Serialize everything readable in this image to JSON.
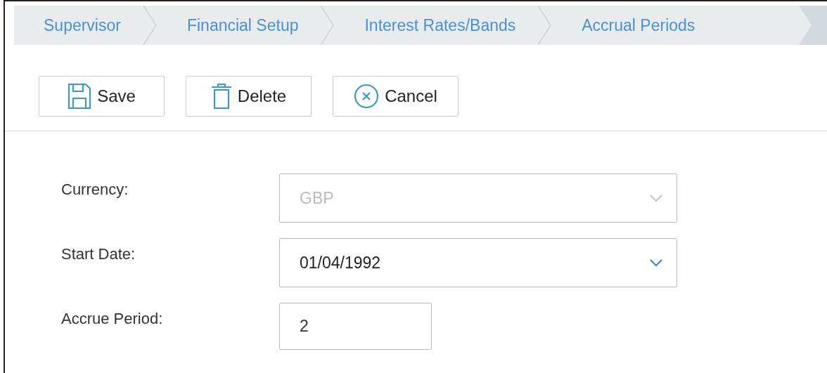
{
  "breadcrumbs": [
    {
      "label": "Supervisor"
    },
    {
      "label": "Financial Setup"
    },
    {
      "label": "Interest Rates/Bands"
    },
    {
      "label": "Accrual Periods"
    }
  ],
  "toolbar": [
    {
      "kind": "save",
      "label": "Save"
    },
    {
      "kind": "delete",
      "label": "Delete"
    },
    {
      "kind": "cancel",
      "label": "Cancel"
    }
  ],
  "fields": [
    {
      "kind": "select",
      "label": "Currency:",
      "value": "GBP",
      "disabled": true
    },
    {
      "kind": "select",
      "label": "Start Date:",
      "value": "01/04/1992",
      "disabled": false
    },
    {
      "kind": "input",
      "label": "Accrue Period:",
      "value": "2",
      "disabled": false
    }
  ]
}
